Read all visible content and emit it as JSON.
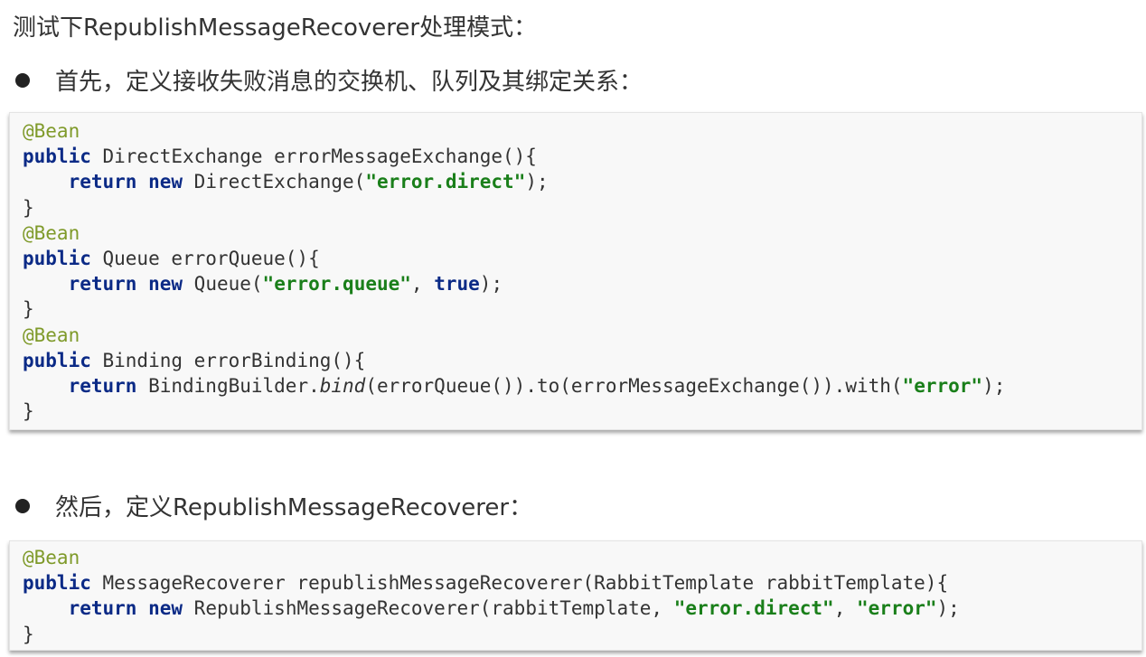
{
  "title": "测试下RepublishMessageRecoverer处理模式：",
  "bullets": [
    "首先，定义接收失败消息的交换机、队列及其绑定关系：",
    "然后，定义RepublishMessageRecoverer："
  ],
  "code1": {
    "l1_ann": "@Bean",
    "l2_kw": "public",
    "l2_rest": " DirectExchange errorMessageExchange(){",
    "l3_indent": "    ",
    "l3_kw1": "return",
    "l3_sp": " ",
    "l3_kw2": "new",
    "l3_mid": " DirectExchange(",
    "l3_str": "\"error.direct\"",
    "l3_end": ");",
    "l4": "}",
    "l5_ann": "@Bean",
    "l6_kw": "public",
    "l6_rest": " Queue errorQueue(){",
    "l7_indent": "    ",
    "l7_kw1": "return",
    "l7_sp": " ",
    "l7_kw2": "new",
    "l7_mid": " Queue(",
    "l7_str": "\"error.queue\"",
    "l7_comma": ", ",
    "l7_kw3": "true",
    "l7_end": ");",
    "l8": "}",
    "l9_ann": "@Bean",
    "l10_kw": "public",
    "l10_rest": " Binding errorBinding(){",
    "l11_indent": "    ",
    "l11_kw1": "return",
    "l11_mid1": " BindingBuilder.",
    "l11_it": "bind",
    "l11_mid2": "(errorQueue()).to(errorMessageExchange()).with(",
    "l11_str": "\"error\"",
    "l11_end": ");",
    "l12": "}"
  },
  "code2": {
    "l1_ann": "@Bean",
    "l2_kw": "public",
    "l2_rest": " MessageRecoverer republishMessageRecoverer(RabbitTemplate rabbitTemplate){",
    "l3_indent": "    ",
    "l3_kw1": "return",
    "l3_sp": " ",
    "l3_kw2": "new",
    "l3_mid": " RepublishMessageRecoverer(rabbitTemplate, ",
    "l3_str1": "\"error.direct\"",
    "l3_comma": ", ",
    "l3_str2": "\"error\"",
    "l3_end": ");",
    "l4": "}"
  }
}
